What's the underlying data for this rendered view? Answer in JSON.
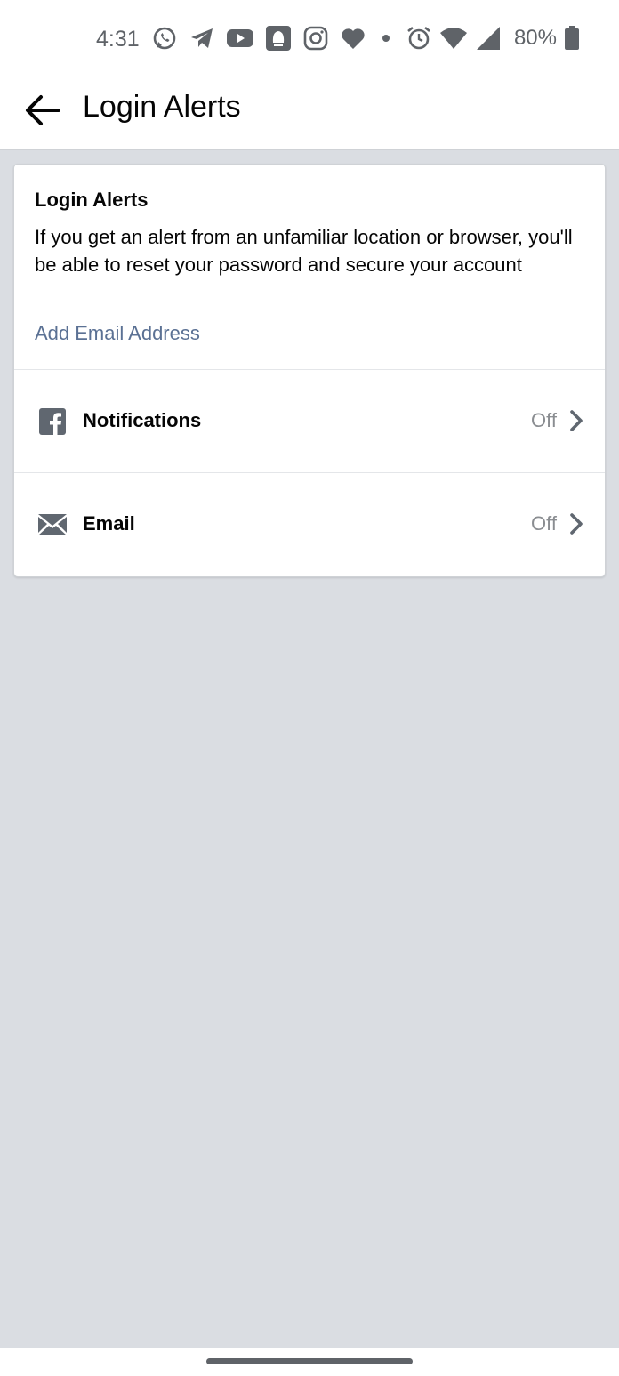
{
  "status_bar": {
    "time": "4:31",
    "battery": "80%",
    "icons": [
      "whatsapp-icon",
      "telegram-icon",
      "youtube-icon",
      "app-badge-icon",
      "instagram-icon",
      "heart-icon",
      "dot-icon",
      "alarm-icon",
      "wifi-icon",
      "signal-icon",
      "battery-icon"
    ]
  },
  "header": {
    "title": "Login Alerts",
    "back_icon": "arrow-left-icon"
  },
  "card": {
    "title": "Login Alerts",
    "description": "If you get an alert from an unfamiliar location or browser, you'll be able to reset your password and secure your account",
    "add_email_label": "Add Email Address",
    "rows": [
      {
        "icon": "facebook-icon",
        "label": "Notifications",
        "value": "Off"
      },
      {
        "icon": "envelope-icon",
        "label": "Email",
        "value": "Off"
      }
    ]
  },
  "colors": {
    "page_background": "#dadde2",
    "link": "#5b7194",
    "secondary_text": "#8a8d91",
    "icon_gray": "#606770"
  }
}
